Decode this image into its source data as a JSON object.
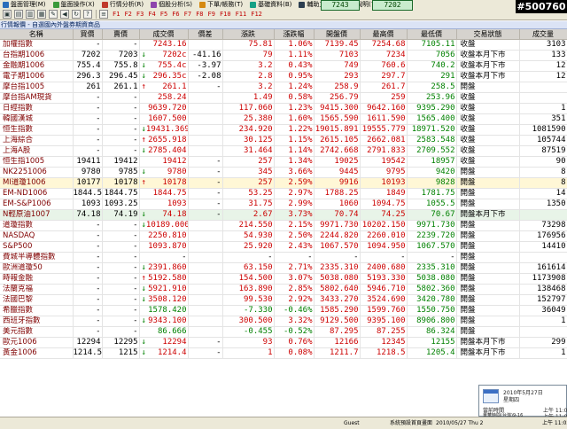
{
  "menu": [
    "盤面管理(M)",
    "盤面操作(X)",
    "行情分析(R)",
    "個股分析(S)",
    "下單/帳務(T)",
    "基礎資料(B)",
    "輔助工具(H)",
    "說明(?)"
  ],
  "toolbar": {
    "fkeys": [
      "F1",
      "F2",
      "F3",
      "F4",
      "F5",
      "F6",
      "F7",
      "F8",
      "F9",
      "F10",
      "F11",
      "F12"
    ]
  },
  "index_boxes": [
    {
      "label": "",
      "value": "7243"
    },
    {
      "label": "",
      "value": "7202"
    }
  ],
  "badge": "#500760",
  "panel_title": "行情報價 - 自選國內外盤券期資商品",
  "columns": [
    "名稱",
    "買價",
    "賣價",
    "成交價",
    "價差",
    "漲跌",
    "漲跌幅",
    "開盤價",
    "最高價",
    "最低價",
    "交易狀態",
    "成交量"
  ],
  "rows": [
    {
      "name": "加權指數",
      "bid": "-",
      "ask": "-",
      "arrow": "",
      "last": "7243.16",
      "spread": "",
      "chg": "75.81",
      "pct": "1.06%",
      "open": "7139.45",
      "high": "7254.68",
      "low": "7105.11",
      "status": "收盤",
      "vol": "3103",
      "dir": "up",
      "hl": false
    },
    {
      "name": "台指期1006",
      "bid": "7202",
      "ask": "7203",
      "arrow": "↓",
      "last": "7202c",
      "spread": "-41.16",
      "chg": "79",
      "pct": "1.11%",
      "open": "7103",
      "high": "7234",
      "low": "7056",
      "status": "收盤本月下市",
      "vol": "133",
      "dir": "up",
      "hl": false
    },
    {
      "name": "金融期1006",
      "bid": "755.4",
      "ask": "755.8",
      "arrow": "↓",
      "last": "755.4c",
      "spread": "-3.97",
      "chg": "3.2",
      "pct": "0.43%",
      "open": "749",
      "high": "760.6",
      "low": "740.2",
      "status": "收盤本月下市",
      "vol": "12",
      "dir": "up",
      "hl": false
    },
    {
      "name": "電子期1006",
      "bid": "296.3",
      "ask": "296.45",
      "arrow": "↓",
      "last": "296.35c",
      "spread": "-2.08",
      "chg": "2.8",
      "pct": "0.95%",
      "open": "293",
      "high": "297.7",
      "low": "291",
      "status": "收盤本月下市",
      "vol": "12",
      "dir": "up",
      "hl": false
    },
    {
      "name": "摩台指1005",
      "bid": "261",
      "ask": "261.1",
      "arrow": "↑",
      "last": "261.1",
      "spread": "-",
      "chg": "3.2",
      "pct": "1.24%",
      "open": "258.9",
      "high": "261.7",
      "low": "258.5",
      "status": "開盤",
      "vol": "",
      "dir": "up",
      "hl": false
    },
    {
      "name": "摩台指AM現貨",
      "bid": "-",
      "ask": "-",
      "arrow": "",
      "last": "258.24",
      "spread": "",
      "chg": "1.49",
      "pct": "0.58%",
      "open": "256.79",
      "high": "259",
      "low": "253.96",
      "status": "收盤",
      "vol": "",
      "dir": "up",
      "hl": false
    },
    {
      "name": "日經指數",
      "bid": "-",
      "ask": "-",
      "arrow": "",
      "last": "9639.720",
      "spread": "",
      "chg": "117.060",
      "pct": "1.23%",
      "open": "9415.300",
      "high": "9642.160",
      "low": "9395.290",
      "status": "收盤",
      "vol": "1",
      "dir": "up",
      "hl": false
    },
    {
      "name": "韓國漢城",
      "bid": "-",
      "ask": "-",
      "arrow": "",
      "last": "1607.500",
      "spread": "",
      "chg": "25.380",
      "pct": "1.60%",
      "open": "1565.590",
      "high": "1611.590",
      "low": "1565.400",
      "status": "收盤",
      "vol": "351",
      "dir": "up",
      "hl": false
    },
    {
      "name": "恒生指數",
      "bid": "-",
      "ask": "-",
      "arrow": "↓",
      "last": "19431.369",
      "spread": "",
      "chg": "234.920",
      "pct": "1.22%",
      "open": "19015.891",
      "high": "19555.779",
      "low": "18971.520",
      "status": "收盤",
      "vol": "1081590",
      "dir": "up",
      "hl": false
    },
    {
      "name": "上海綜合",
      "bid": "-",
      "ask": "-",
      "arrow": "↑",
      "last": "2655.918",
      "spread": "",
      "chg": "30.125",
      "pct": "1.15%",
      "open": "2615.105",
      "high": "2662.081",
      "low": "2583.548",
      "status": "收盤",
      "vol": "105744",
      "dir": "up",
      "hl": false
    },
    {
      "name": "上海A股",
      "bid": "-",
      "ask": "-",
      "arrow": "↓",
      "last": "2785.404",
      "spread": "",
      "chg": "31.464",
      "pct": "1.14%",
      "open": "2742.668",
      "high": "2791.833",
      "low": "2709.552",
      "status": "收盤",
      "vol": "87519",
      "dir": "up",
      "hl": false
    },
    {
      "name": "恒生指1005",
      "bid": "19411",
      "ask": "19412",
      "arrow": "",
      "last": "19412",
      "spread": "-",
      "chg": "257",
      "pct": "1.34%",
      "open": "19025",
      "high": "19542",
      "low": "18957",
      "status": "收盤",
      "vol": "90",
      "dir": "up",
      "hl": false
    },
    {
      "name": "NK2251006",
      "bid": "9780",
      "ask": "9785",
      "arrow": "↓",
      "last": "9780",
      "spread": "-",
      "chg": "345",
      "pct": "3.66%",
      "open": "9445",
      "high": "9795",
      "low": "9420",
      "status": "開盤",
      "vol": "8",
      "dir": "up",
      "hl": false
    },
    {
      "name": "MI道瓊1006",
      "bid": "10177",
      "ask": "10178",
      "arrow": "↑",
      "last": "10178",
      "spread": "-",
      "chg": "257",
      "pct": "2.59%",
      "open": "9916",
      "high": "10193",
      "low": "9828",
      "status": "開盤",
      "vol": "8",
      "dir": "up",
      "hl": true
    },
    {
      "name": "EM-ND1006",
      "bid": "1844.5",
      "ask": "1844.75",
      "arrow": "",
      "last": "1844.75",
      "spread": "-",
      "chg": "53.25",
      "pct": "2.97%",
      "open": "1788.25",
      "high": "1849",
      "low": "1781.75",
      "status": "開盤",
      "vol": "14",
      "dir": "up",
      "hl": false
    },
    {
      "name": "EM-S&P1006",
      "bid": "1093",
      "ask": "1093.25",
      "arrow": "",
      "last": "1093",
      "spread": "-",
      "chg": "31.75",
      "pct": "2.99%",
      "open": "1060",
      "high": "1094.75",
      "low": "1055.5",
      "status": "開盤",
      "vol": "1350",
      "dir": "up",
      "hl": false
    },
    {
      "name": "N輕原油1007",
      "bid": "74.18",
      "ask": "74.19",
      "arrow": "↓",
      "last": "74.18",
      "spread": "-",
      "chg": "2.67",
      "pct": "3.73%",
      "open": "70.74",
      "high": "74.25",
      "low": "70.67",
      "status": "開盤本月下市",
      "vol": "",
      "dir": "up",
      "hl": false,
      "sel": true
    },
    {
      "name": "道瓊指數",
      "bid": "-",
      "ask": "-",
      "arrow": "↓",
      "last": "10189.000",
      "spread": "",
      "chg": "214.550",
      "pct": "2.15%",
      "open": "9971.730",
      "high": "10202.150",
      "low": "9971.730",
      "status": "開盤",
      "vol": "73298",
      "dir": "up",
      "hl": false
    },
    {
      "name": "NASDAQ",
      "bid": "-",
      "ask": "-",
      "arrow": "",
      "last": "2250.810",
      "spread": "",
      "chg": "54.930",
      "pct": "2.50%",
      "open": "2244.820",
      "high": "2260.010",
      "low": "2239.720",
      "status": "開盤",
      "vol": "176956",
      "dir": "up",
      "hl": false
    },
    {
      "name": "S&P500",
      "bid": "-",
      "ask": "-",
      "arrow": "",
      "last": "1093.870",
      "spread": "",
      "chg": "25.920",
      "pct": "2.43%",
      "open": "1067.570",
      "high": "1094.950",
      "low": "1067.570",
      "status": "開盤",
      "vol": "14410",
      "dir": "up",
      "hl": false
    },
    {
      "name": "費城半導體指數",
      "bid": "-",
      "ask": "-",
      "arrow": "",
      "last": "-",
      "spread": "",
      "chg": "-",
      "pct": "-",
      "open": "-",
      "high": "-",
      "low": "-",
      "status": "開盤",
      "vol": "",
      "dir": "fl",
      "hl": false
    },
    {
      "name": "歐洲道瓊50",
      "bid": "-",
      "ask": "-",
      "arrow": "↓",
      "last": "2391.860",
      "spread": "",
      "chg": "63.150",
      "pct": "2.71%",
      "open": "2335.310",
      "high": "2400.680",
      "low": "2335.310",
      "status": "開盤",
      "vol": "161614",
      "dir": "up",
      "hl": false
    },
    {
      "name": "時報金融",
      "bid": "-",
      "ask": "-",
      "arrow": "↑",
      "last": "5192.580",
      "spread": "",
      "chg": "154.500",
      "pct": "3.07%",
      "open": "5038.080",
      "high": "5193.330",
      "low": "5038.080",
      "status": "開盤",
      "vol": "1173908",
      "dir": "up",
      "hl": false
    },
    {
      "name": "法蘭克福",
      "bid": "-",
      "ask": "-",
      "arrow": "↓",
      "last": "5921.910",
      "spread": "",
      "chg": "163.890",
      "pct": "2.85%",
      "open": "5802.640",
      "high": "5946.710",
      "low": "5802.360",
      "status": "開盤",
      "vol": "138468",
      "dir": "up",
      "hl": false
    },
    {
      "name": "法國巴黎",
      "bid": "-",
      "ask": "-",
      "arrow": "↓",
      "last": "3508.120",
      "spread": "",
      "chg": "99.530",
      "pct": "2.92%",
      "open": "3433.270",
      "high": "3524.690",
      "low": "3420.780",
      "status": "開盤",
      "vol": "152797",
      "dir": "up",
      "hl": false
    },
    {
      "name": "希臘指數",
      "bid": "-",
      "ask": "-",
      "arrow": "",
      "last": "1578.420",
      "spread": "",
      "chg": "-7.330",
      "pct": "-0.46%",
      "open": "1585.290",
      "high": "1599.760",
      "low": "1550.750",
      "status": "開盤",
      "vol": "36049",
      "dir": "dn",
      "hl": false
    },
    {
      "name": "西班牙指數",
      "bid": "-",
      "ask": "-",
      "arrow": "↓",
      "last": "9343.100",
      "spread": "",
      "chg": "300.500",
      "pct": "3.32%",
      "open": "9129.500",
      "high": "9395.100",
      "low": "8906.800",
      "status": "開盤",
      "vol": "1",
      "dir": "up",
      "hl": false
    },
    {
      "name": "美元指數",
      "bid": "-",
      "ask": "-",
      "arrow": "",
      "last": "86.666",
      "spread": "",
      "chg": "-0.455",
      "pct": "-0.52%",
      "open": "87.295",
      "high": "87.255",
      "low": "86.324",
      "status": "開盤",
      "vol": "",
      "dir": "dn",
      "hl": false
    },
    {
      "name": "歐元1006",
      "bid": "12294",
      "ask": "12295",
      "arrow": "↓",
      "last": "12294",
      "spread": "-",
      "chg": "93",
      "pct": "0.76%",
      "open": "12166",
      "high": "12345",
      "low": "12155",
      "status": "開盤本月下市",
      "vol": "299",
      "dir": "up",
      "hl": false
    },
    {
      "name": "黃金1006",
      "bid": "1214.5",
      "ask": "1215",
      "arrow": "↓",
      "last": "1214.4",
      "spread": "-",
      "chg": "1",
      "pct": "0.08%",
      "open": "1211.7",
      "high": "1218.5",
      "low": "1205.4",
      "status": "開盤本月下市",
      "vol": "1",
      "dir": "up",
      "hl": false
    }
  ],
  "statusbar": {
    "user": "Guest",
    "msg": "系統預設首頁畫面",
    "datetime": "2010/05/27 Thu 2",
    "extra": "",
    "clock": "上午 11:02"
  },
  "clock_popup": {
    "date": "2010年5月27日",
    "weekday": "星期四",
    "line1": "當前時間",
    "time1": "上午 11:02",
    "line2": "東華時間(台灣)9-16",
    "time2": "上午 11:02"
  }
}
